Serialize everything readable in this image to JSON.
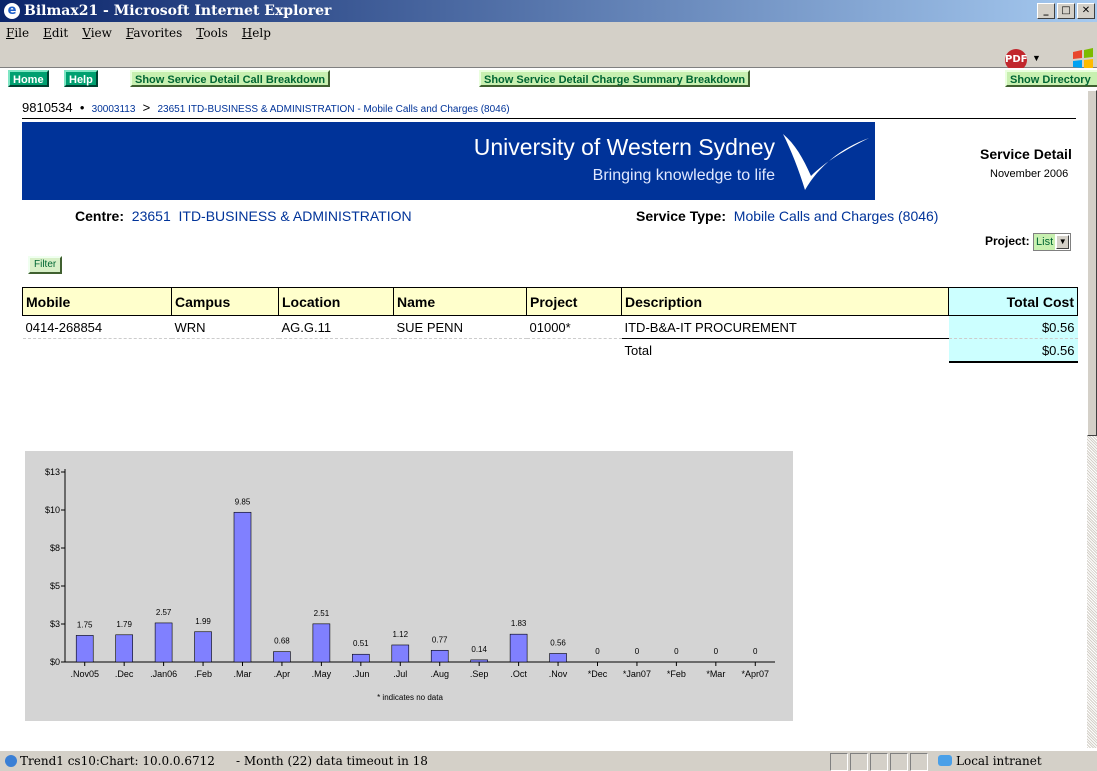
{
  "window": {
    "title": "Bilmax21 - Microsoft Internet Explorer"
  },
  "menu": {
    "items": [
      "File",
      "Edit",
      "View",
      "Favorites",
      "Tools",
      "Help"
    ]
  },
  "nav": {
    "home": "Home",
    "help": "Help",
    "call_breakdown": "Show Service Detail Call Breakdown",
    "charge_summary": "Show Service Detail Charge Summary Breakdown",
    "directory": "Show Directory"
  },
  "breadcrumb": {
    "account": "9810534",
    "bullet": "•",
    "link1": "30003113",
    "sep": ">",
    "link2": "23651 ITD-BUSINESS & ADMINISTRATION - Mobile Calls and Charges (8046)"
  },
  "banner": {
    "line1": "University of Western Sydney",
    "line2": "Bringing knowledge to life"
  },
  "report": {
    "title": "Service Detail",
    "period": "November 2006"
  },
  "centre": {
    "label": "Centre:",
    "value": "23651  ITD-BUSINESS & ADMINISTRATION"
  },
  "service_type": {
    "label": "Service Type:",
    "value": "Mobile Calls and Charges (8046)"
  },
  "project": {
    "label": "Project:",
    "value": "List"
  },
  "filter": {
    "label": "Filter"
  },
  "table": {
    "headers": [
      "Mobile",
      "Campus",
      "Location",
      "Name",
      "Project",
      "Description",
      "Total Cost"
    ],
    "row": {
      "mobile": "0414-268854",
      "campus": "WRN",
      "location": "AG.G.11",
      "name": "SUE PENN",
      "project": "01000*",
      "description": "ITD-B&A-IT PROCUREMENT",
      "cost": "$0.56"
    },
    "total": {
      "label": "Total",
      "cost": "$0.56"
    }
  },
  "chart_data": {
    "type": "bar",
    "categories": [
      ".Nov05",
      ".Dec",
      ".Jan06",
      ".Feb",
      ".Mar",
      ".Apr",
      ".May",
      ".Jun",
      ".Jul",
      ".Aug",
      ".Sep",
      ".Oct",
      ".Nov",
      "*Dec",
      "*Jan07",
      "*Feb",
      "*Mar",
      "*Apr07"
    ],
    "values": [
      1.75,
      1.79,
      2.57,
      1.99,
      9.85,
      0.68,
      2.51,
      0.51,
      1.12,
      0.77,
      0.14,
      1.83,
      0.56,
      0,
      0,
      0,
      0,
      0
    ],
    "value_labels": [
      "1.75",
      "1.79",
      "2.57",
      "1.99",
      "9.85",
      "0.68",
      "2.51",
      "0.51",
      "1.12",
      "0.77",
      "0.14",
      "1.83",
      "0.56",
      "0",
      "0",
      "0",
      "0",
      "0"
    ],
    "yticks": [
      0,
      2.5,
      5,
      7.5,
      10,
      12.5
    ],
    "ytick_labels": [
      "$0",
      "$3",
      "$5",
      "$8",
      "$10",
      "$13"
    ],
    "ylim": [
      0,
      12.5
    ],
    "note": "* indicates no data",
    "bar_color": "#8080ff",
    "background": "#d4d4d4"
  },
  "status": {
    "left": "Trend1 cs10:Chart: 10.0.0.6712",
    "middle": "- Month (22) data timeout in 18",
    "zone": "Local intranet"
  }
}
